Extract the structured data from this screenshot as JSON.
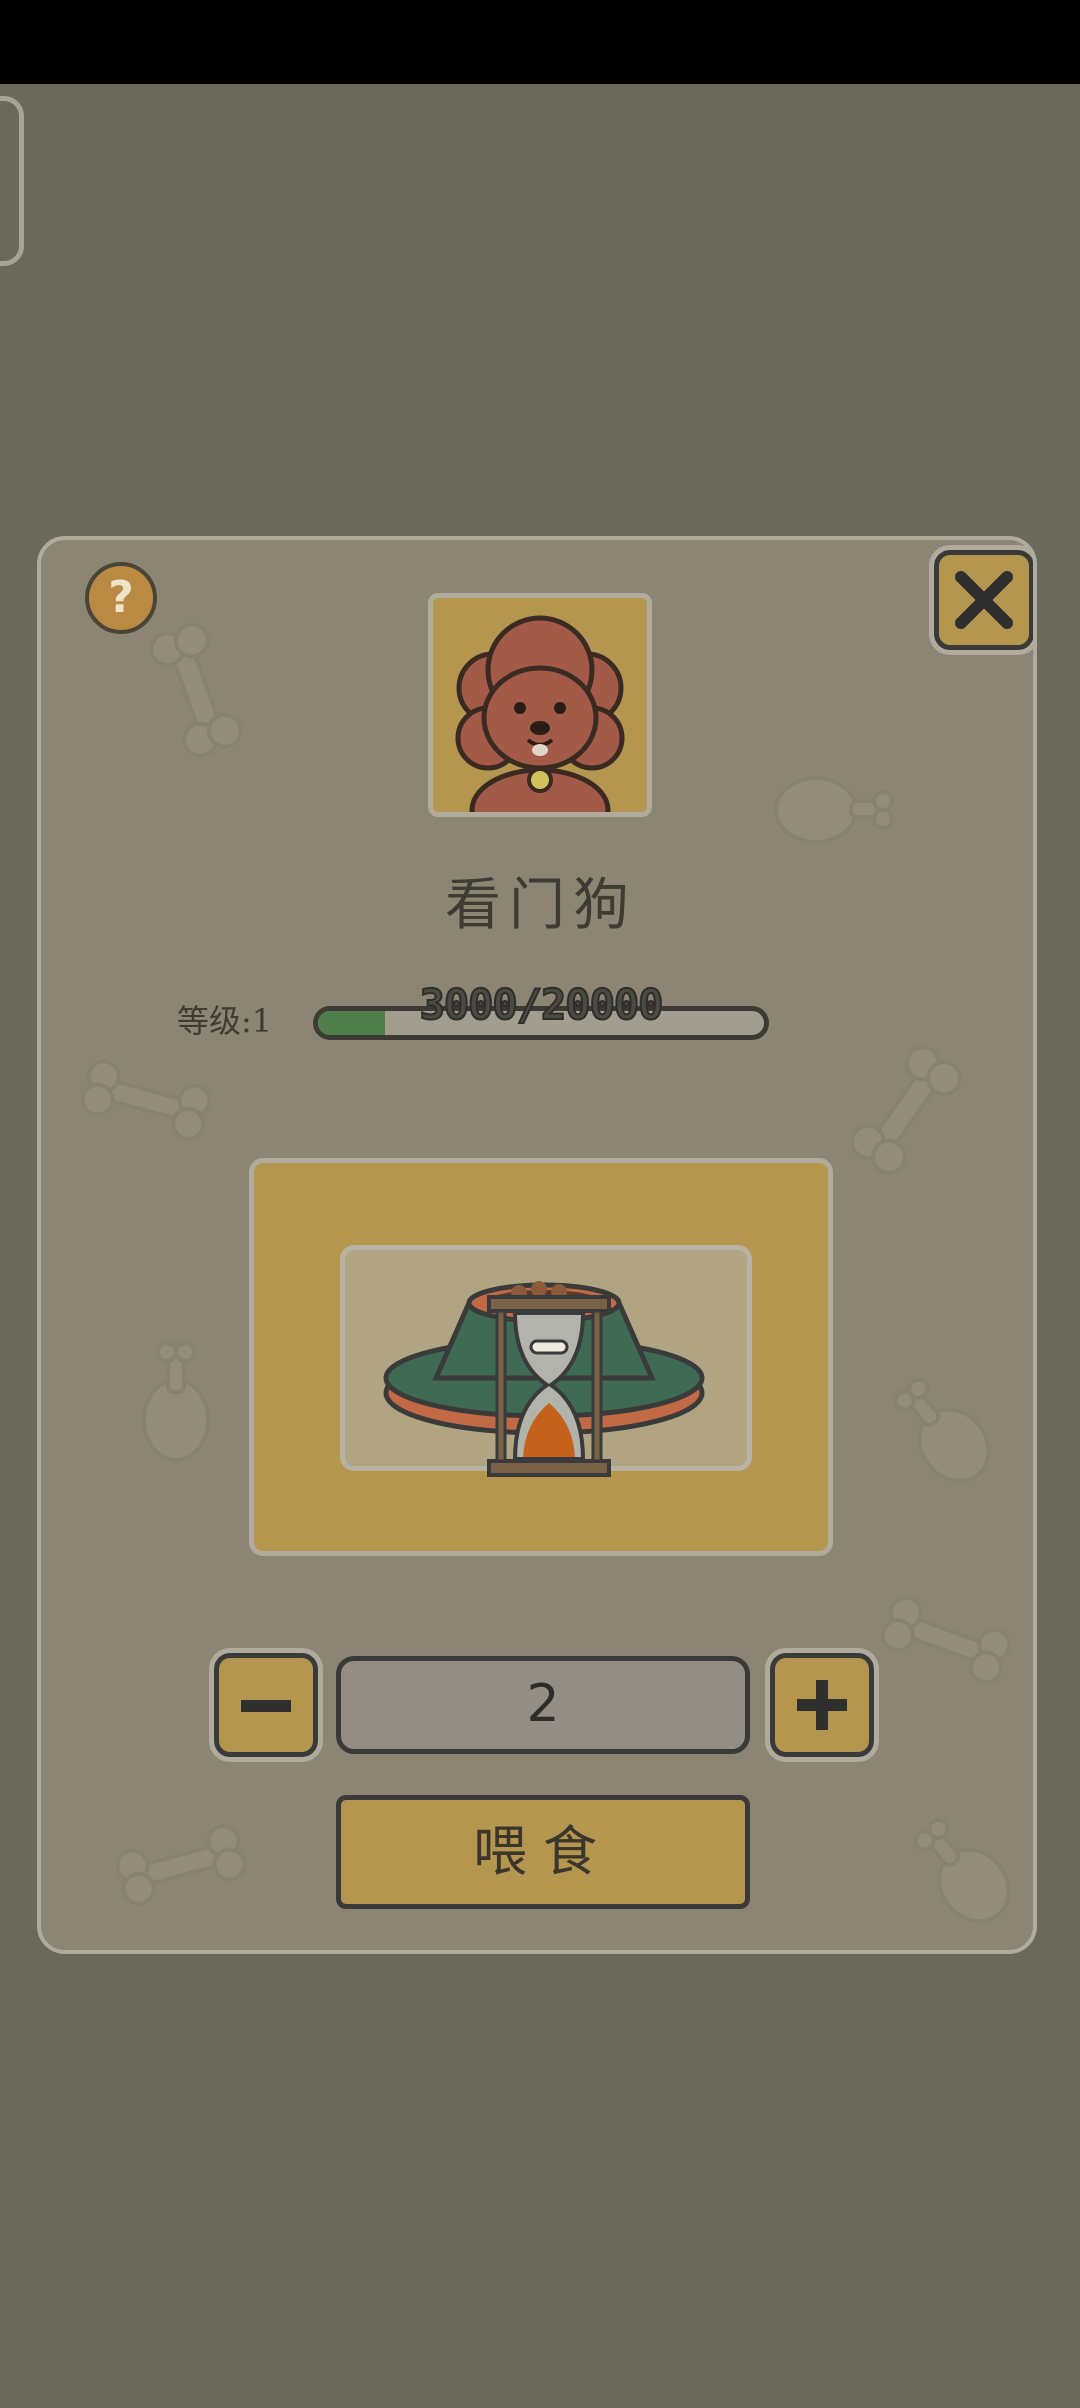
{
  "pet": {
    "name": "看门狗"
  },
  "level": {
    "label": "等级:1",
    "progress_text": "3000/20000",
    "progress_fraction": 0.15
  },
  "help": {
    "label": "?"
  },
  "quantity": {
    "value": "2"
  },
  "actions": {
    "feed_label": "喂食"
  },
  "colors": {
    "overlay": "#6b695c",
    "panel": "#8c8573",
    "button": "#b5964f",
    "exp_fill": "#4f7d4c"
  }
}
